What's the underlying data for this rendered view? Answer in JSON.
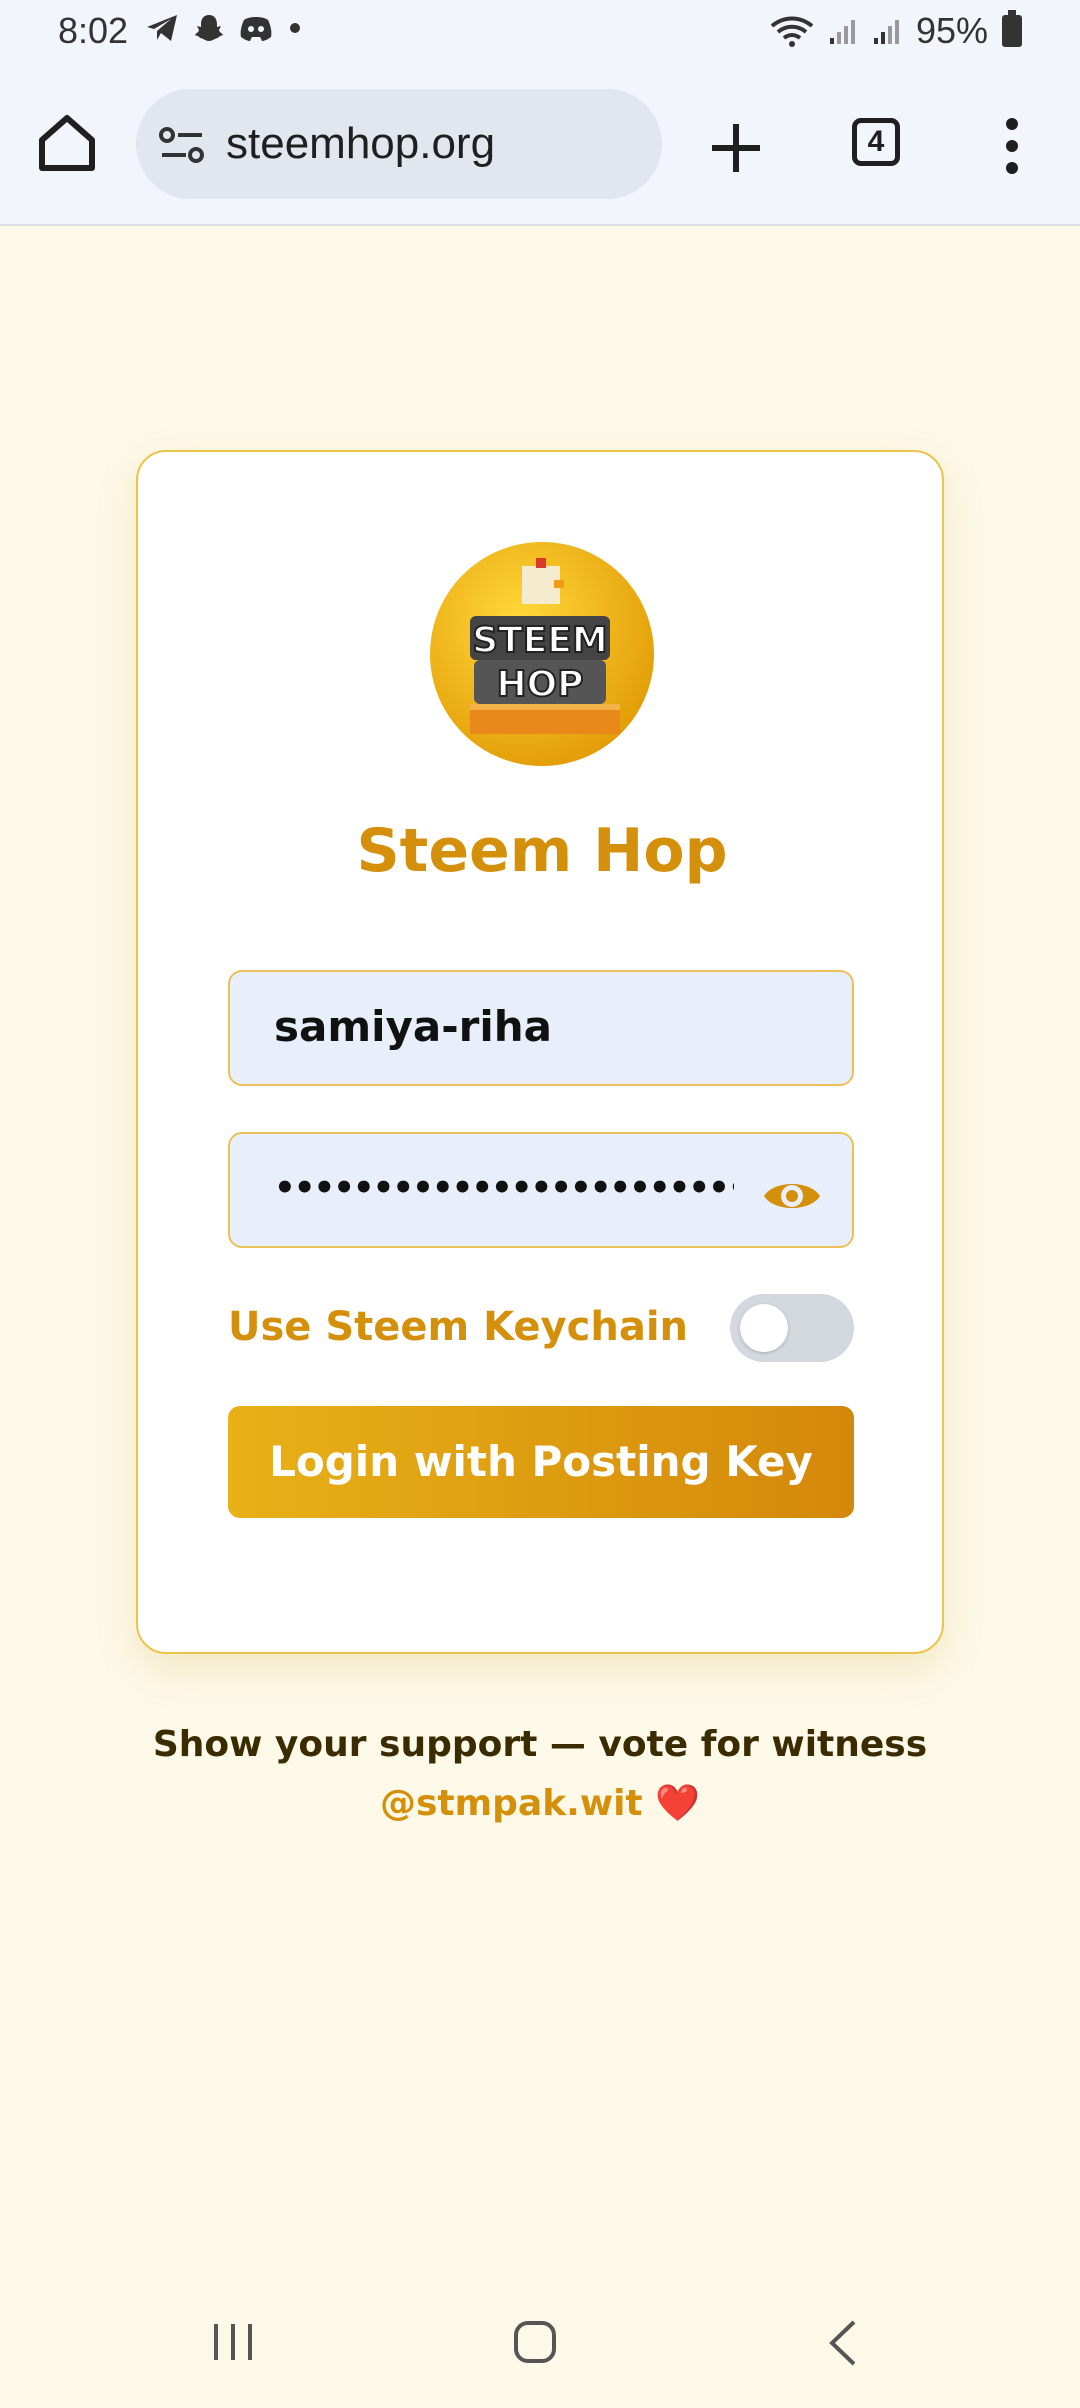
{
  "status_bar": {
    "time": "8:02",
    "battery": "95%"
  },
  "browser": {
    "url": "steemhop.org",
    "tab_count": "4"
  },
  "login_card": {
    "title": "Steem Hop",
    "username_value": "samiya-riha",
    "password_masked": "••••••••••••••••••••••••••••••••",
    "keychain_label": "Use Steem Keychain",
    "keychain_enabled": false,
    "login_button": "Login with Posting Key",
    "logo_text": [
      "STEEM",
      "HOP"
    ]
  },
  "support": {
    "line1": "Show your support — vote for witness",
    "link": "@stmpak.wit",
    "heart": "❤️"
  },
  "colors": {
    "accent": "#d4900b",
    "background": "#fdf9e8",
    "card_border": "#eec34a"
  }
}
